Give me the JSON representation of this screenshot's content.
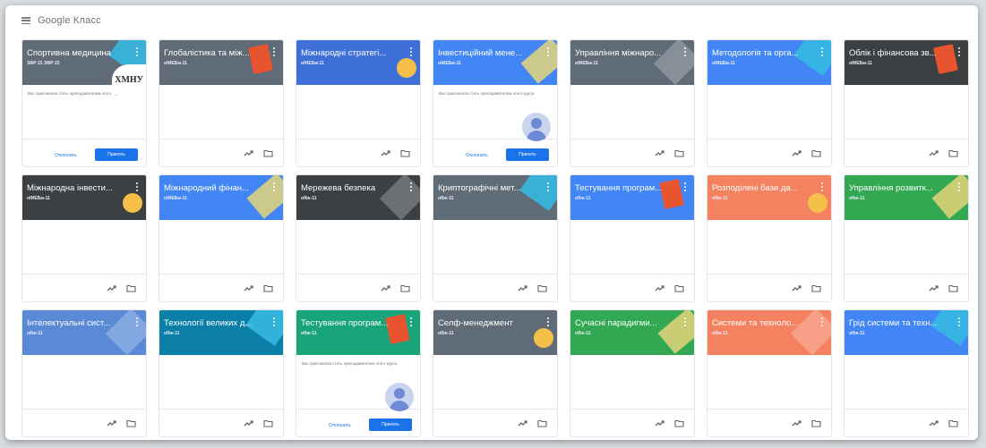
{
  "app": {
    "title": "Google Класс"
  },
  "invite": {
    "text": "Вас пригласили стать преподавателем этого курса",
    "decline": "Отклонить",
    "accept": "Принять"
  },
  "logo": {
    "text": "ХМНУ"
  },
  "colors": {
    "slate": "#52606d",
    "dark": "#3c4043",
    "blue": "#4285f4",
    "teal": "#0b8043",
    "green": "#33a852",
    "orange": "#f4815f",
    "photo": "#5a8ad6"
  },
  "courses": [
    {
      "title": "Спортивна медицина",
      "sub": "ЗФР 21 ЗФР 22",
      "color": "#5f6b77",
      "invite": true,
      "logo": true
    },
    {
      "title": "Глобалістика та між...",
      "sub": "ofИЕБм-11",
      "color": "#5f6b77"
    },
    {
      "title": "Міжнародні стратегі...",
      "sub": "ofИЕБм-11",
      "color": "#3f6fd8"
    },
    {
      "title": "Інвестиційний мене...",
      "sub": "ofИЕБм-11",
      "color": "#4285f4",
      "invite": true,
      "avatar": true
    },
    {
      "title": "Управління міжнаро...",
      "sub": "ofИЕБм-11",
      "color": "#5f6b77"
    },
    {
      "title": "Методологія та орга...",
      "sub": "ofИЕБм-11",
      "color": "#4285f4"
    },
    {
      "title": "Облік і фінансова зв...",
      "sub": "ofИЕБм-11",
      "color": "#3c4043"
    },
    {
      "title": "Міжнародна інвести...",
      "sub": "ofИЕБм-11",
      "color": "#3c4043"
    },
    {
      "title": "Міжнародний фінан...",
      "sub": "ofИЕБм-11",
      "color": "#4285f4"
    },
    {
      "title": "Мережева безпека",
      "sub": "ofbe-11",
      "color": "#3c4043"
    },
    {
      "title": "Криптографічні мет...",
      "sub": "ofbe-11",
      "color": "#5f6b77"
    },
    {
      "title": "Тестування програм...",
      "sub": "ofbe-11",
      "color": "#4285f4"
    },
    {
      "title": "Розподілені бази да...",
      "sub": "ofbe-11",
      "color": "#f4815f"
    },
    {
      "title": "Управління розвитк...",
      "sub": "ofbe-11",
      "color": "#33a852"
    },
    {
      "title": "Інтелектуальні сист...",
      "sub": "ofbe-11",
      "color": "#5a8ad6"
    },
    {
      "title": "Технології великих д...",
      "sub": "ofbe-11",
      "color": "#0b7fa8"
    },
    {
      "title": "Тестування програм...",
      "sub": "ofbe-11",
      "color": "#19a47a",
      "invite": true,
      "avatar": true
    },
    {
      "title": "Селф-менеджмент",
      "sub": "ofbe-11",
      "color": "#5f6b77"
    },
    {
      "title": "Сучасні парадигми...",
      "sub": "ofbe-11",
      "color": "#33a852"
    },
    {
      "title": "Системи та техноло...",
      "sub": "ofbe-11",
      "color": "#f4815f"
    },
    {
      "title": "Грід системи та техн...",
      "sub": "ofbe-11",
      "color": "#4285f4"
    }
  ]
}
